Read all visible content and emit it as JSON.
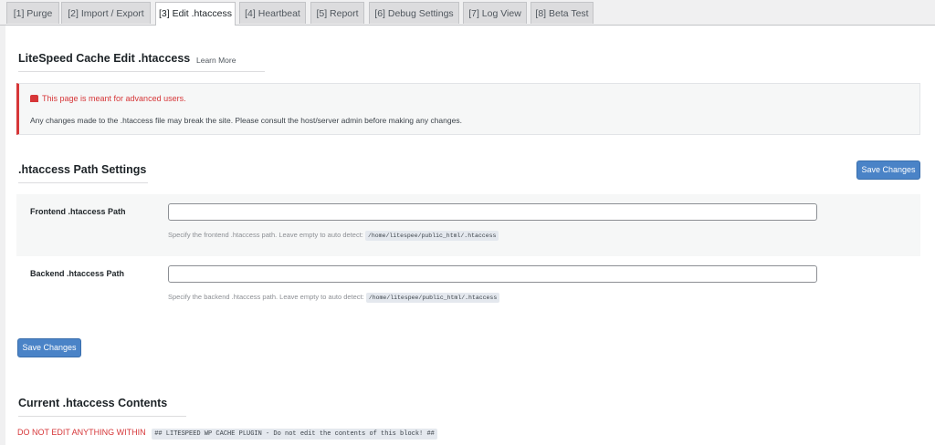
{
  "tabs": [
    {
      "label": "[1] Purge",
      "active": false
    },
    {
      "label": "[2] Import / Export",
      "active": false
    },
    {
      "label": "[3] Edit .htaccess",
      "active": true
    },
    {
      "label": "[4] Heartbeat",
      "active": false
    },
    {
      "label": "[5] Report",
      "active": false
    },
    {
      "label": "[6] Debug Settings",
      "active": false
    },
    {
      "label": "[7] Log View",
      "active": false
    },
    {
      "label": "[8] Beta Test",
      "active": false
    }
  ],
  "page": {
    "title": "LiteSpeed Cache Edit .htaccess",
    "learn_more": "Learn More"
  },
  "notice": {
    "icon": "alert-icon",
    "title": "This page is meant for advanced users.",
    "body": "Any changes made to the .htaccess file may break the site. Please consult the host/server admin before making any changes."
  },
  "path_settings": {
    "title": ".htaccess Path Settings",
    "save_label": "Save Changes",
    "frontend": {
      "label": "Frontend .htaccess Path",
      "value": "",
      "desc": "Specify the frontend .htaccess path. Leave empty to auto detect:",
      "default": "/home/litespee/public_html/.htaccess"
    },
    "backend": {
      "label": "Backend .htaccess Path",
      "value": "",
      "desc": "Specify the backend .htaccess path. Leave empty to auto detect:",
      "default": "/home/litespee/public_html/.htaccess"
    },
    "save_bottom_label": "Save Changes"
  },
  "contents": {
    "title": "Current .htaccess Contents",
    "warning": "DO NOT EDIT ANYTHING WITHIN",
    "marker": "## LITESPEED WP CACHE PLUGIN - Do not edit the contents of this block! ##"
  },
  "colors": {
    "accent": "#4a83c7",
    "danger": "#d63638"
  }
}
